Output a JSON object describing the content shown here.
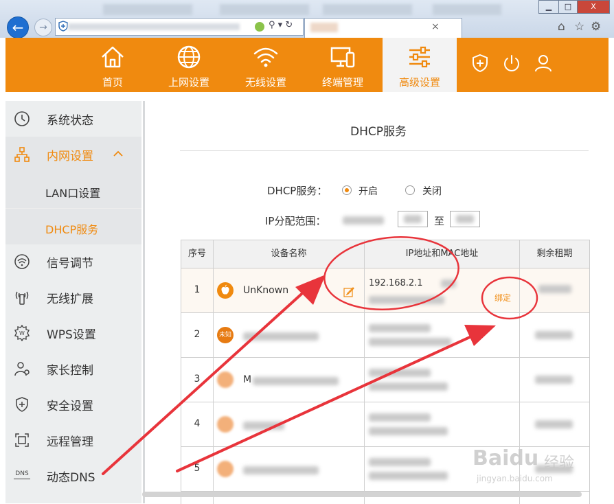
{
  "browser": {
    "tab_close": "×",
    "min": "▁",
    "max": "□",
    "close": "X"
  },
  "nav": [
    {
      "label": "首页",
      "icon": "home-icon"
    },
    {
      "label": "上网设置",
      "icon": "globe-icon"
    },
    {
      "label": "无线设置",
      "icon": "wifi-icon"
    },
    {
      "label": "终端管理",
      "icon": "devices-icon"
    },
    {
      "label": "高级设置",
      "icon": "sliders-icon"
    }
  ],
  "sidebar": {
    "items": [
      {
        "label": "系统状态",
        "icon": "clock-icon"
      },
      {
        "label": "内网设置",
        "icon": "network-icon"
      },
      {
        "label": "LAN口设置"
      },
      {
        "label": "DHCP服务"
      },
      {
        "label": "信号调节",
        "icon": "signal-icon"
      },
      {
        "label": "无线扩展",
        "icon": "antenna-icon"
      },
      {
        "label": "WPS设置",
        "icon": "wps-gear-icon"
      },
      {
        "label": "家长控制",
        "icon": "parent-icon"
      },
      {
        "label": "安全设置",
        "icon": "shield-icon"
      },
      {
        "label": "远程管理",
        "icon": "remote-icon"
      },
      {
        "label": "动态DNS",
        "icon": "dns-icon"
      }
    ],
    "dns_icon_text": "DNS"
  },
  "main": {
    "title": "DHCP服务",
    "dhcp_label": "DHCP服务：",
    "radio_on": "开启",
    "radio_off": "关闭",
    "range_label": "IP分配范围：",
    "range_to": "至",
    "table": {
      "headers": [
        "序号",
        "设备名称",
        "IP地址和MAC地址",
        "剩余租期"
      ],
      "rows": [
        {
          "idx": "1",
          "name": "UnKnown",
          "ip": "192.168.2.1",
          "bind": "绑定"
        },
        {
          "idx": "2",
          "icon_text": "未知"
        },
        {
          "idx": "3",
          "name_partial": "M"
        },
        {
          "idx": "4"
        },
        {
          "idx": "5"
        }
      ]
    }
  },
  "watermark": {
    "brand": "Baidu",
    "cn": "经验",
    "url": "jingyan.baidu.com"
  },
  "colors": {
    "accent": "#f08a0f",
    "annotation": "#e8343b"
  }
}
